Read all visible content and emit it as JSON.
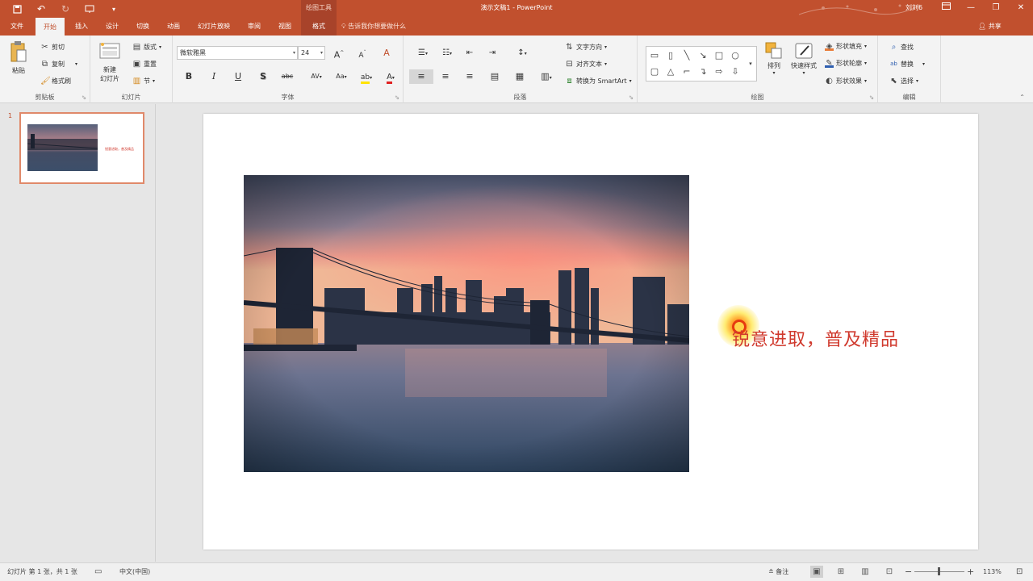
{
  "titlebar": {
    "qat": {
      "save_icon": "save-icon",
      "undo_icon": "undo-icon",
      "redo_icon": "redo-icon",
      "present_icon": "present-icon",
      "customize_icon": "customize-icon"
    },
    "context_tool_title": "绘图工具",
    "doc_title": "演示文稿1  -  PowerPoint",
    "user": "刘刘6",
    "ribbon_display_icon": "ribbon-display-icon",
    "minimize": "—",
    "restore": "❐",
    "close": "✕"
  },
  "tabs": [
    {
      "label": "文件"
    },
    {
      "label": "开始",
      "active": true
    },
    {
      "label": "插入"
    },
    {
      "label": "设计"
    },
    {
      "label": "切换"
    },
    {
      "label": "动画"
    },
    {
      "label": "幻灯片放映"
    },
    {
      "label": "审阅"
    },
    {
      "label": "视图"
    },
    {
      "label": "格式",
      "contextual": true
    }
  ],
  "tell_me": "告诉我你想要做什么",
  "share": "共享",
  "ribbon": {
    "clipboard": {
      "label": "剪贴板",
      "paste": "粘贴",
      "cut": "剪切",
      "copy": "复制",
      "format_painter": "格式刷"
    },
    "slides": {
      "label": "幻灯片",
      "new_slide_line1": "新建",
      "new_slide_line2": "幻灯片",
      "layout": "版式",
      "reset": "重置",
      "section": "节"
    },
    "font": {
      "label": "字体",
      "font_name": "微软雅黑",
      "font_size": "24",
      "bold": "B",
      "italic": "I",
      "underline": "U",
      "shadow": "S",
      "strike": "abc",
      "spacing": "AV",
      "case": "Aa",
      "grow": "A",
      "shrink": "A",
      "clear": "A"
    },
    "paragraph": {
      "label": "段落",
      "text_direction": "文字方向",
      "align_text": "对齐文本",
      "smartart": "转换为 SmartArt"
    },
    "drawing": {
      "label": "绘图",
      "arrange": "排列",
      "quick_styles": "快速样式",
      "shape_fill": "形状填充",
      "shape_outline": "形状轮廓",
      "shape_effects": "形状效果"
    },
    "editing": {
      "label": "编辑",
      "find": "查找",
      "replace": "替换",
      "select": "选择"
    }
  },
  "thumbnails": [
    {
      "number": "1",
      "text": "锐意进取，普及精品"
    }
  ],
  "slide": {
    "text": "锐意进取，普及精品"
  },
  "statusbar": {
    "slide_info": "幻灯片 第 1 张，共 1 张",
    "language": "中文(中国)",
    "notes": "备注",
    "zoom_minus": "−",
    "zoom_plus": "+",
    "zoom": "113%"
  },
  "colors": {
    "accent": "#c1502e",
    "slide_text": "#d03a2e"
  }
}
